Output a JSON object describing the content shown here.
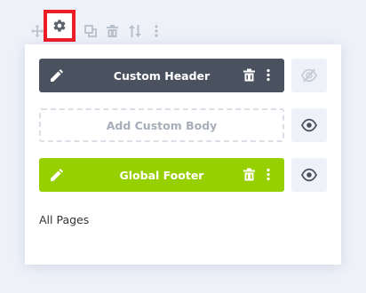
{
  "toolbar": {
    "icons": [
      "move-icon",
      "gear-icon",
      "duplicate-icon",
      "trash-icon",
      "sort-icon",
      "more-vertical-icon"
    ],
    "highlight_color": "#ee1c24"
  },
  "templates": {
    "header": {
      "label": "Custom Header",
      "color": "#4a5260",
      "visible": false
    },
    "body": {
      "label": "Add Custom Body",
      "visible": true
    },
    "footer": {
      "label": "Global Footer",
      "color": "#97d000",
      "visible": true
    }
  },
  "assignment": {
    "label": "All Pages"
  }
}
